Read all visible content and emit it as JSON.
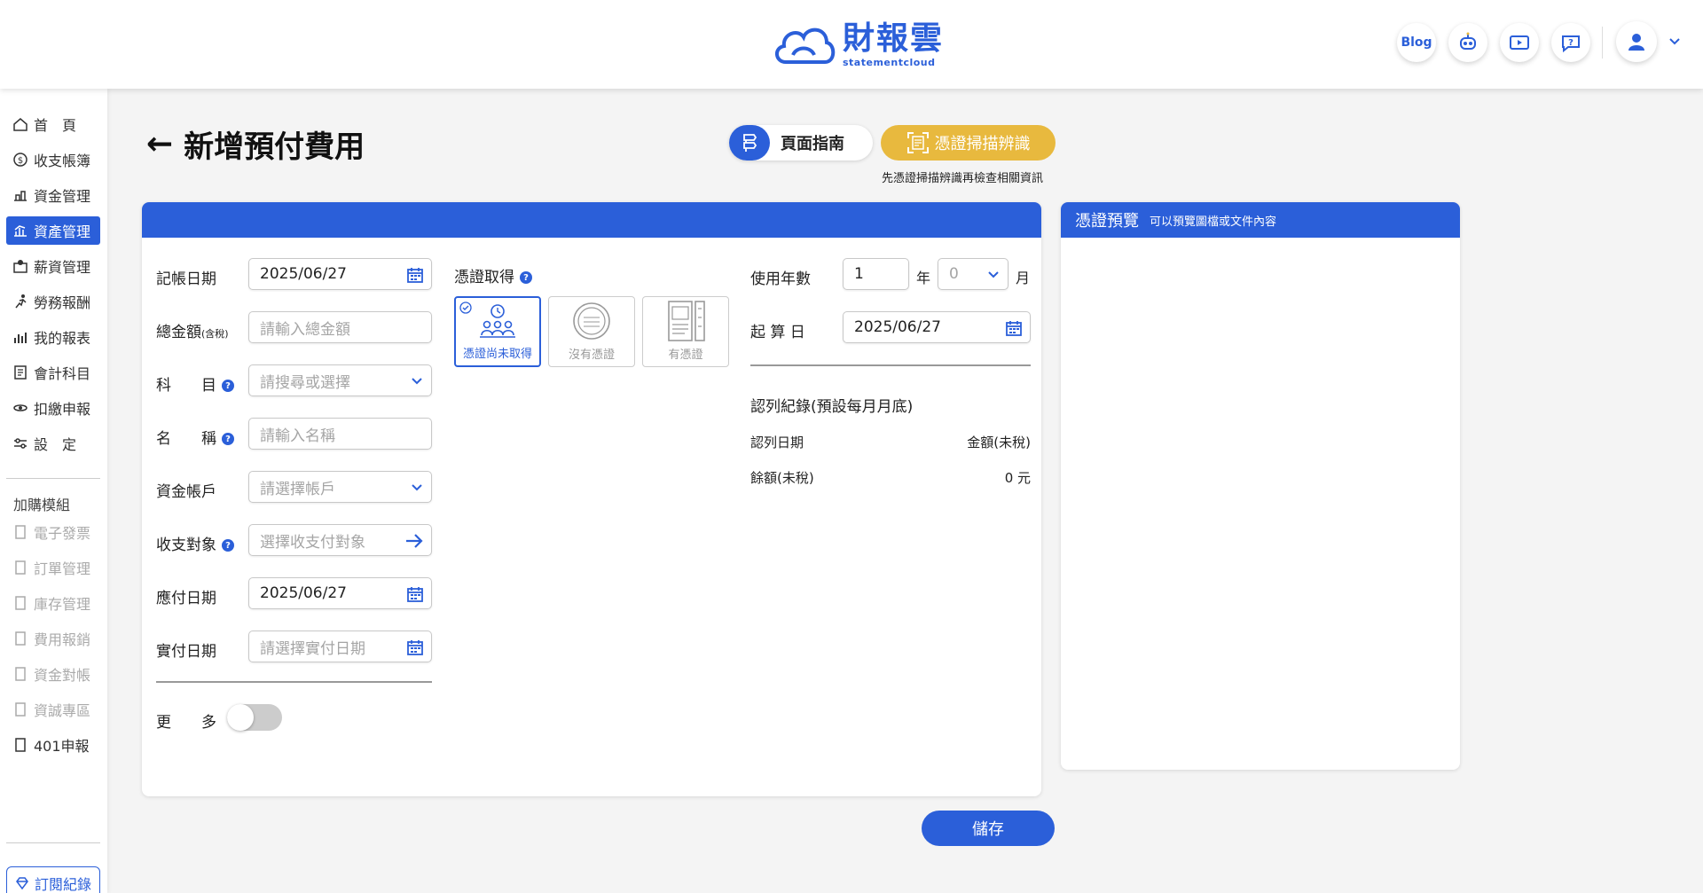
{
  "header": {
    "brand_cn": "財報雲",
    "brand_en": "statementcloud",
    "blog_label": "Blog"
  },
  "sidebar": {
    "items": [
      {
        "label": "首　頁",
        "icon": "home-icon"
      },
      {
        "label": "收支帳簿",
        "icon": "coin-icon"
      },
      {
        "label": "資金管理",
        "icon": "fund-icon"
      },
      {
        "label": "資產管理",
        "icon": "asset-chart-icon"
      },
      {
        "label": "薪資管理",
        "icon": "salary-icon"
      },
      {
        "label": "勞務報酬",
        "icon": "runner-icon"
      },
      {
        "label": "我的報表",
        "icon": "report-chart-icon"
      },
      {
        "label": "會計科目",
        "icon": "ledger-icon"
      },
      {
        "label": "扣繳申報",
        "icon": "tax-icon"
      },
      {
        "label": "設　定",
        "icon": "settings-sliders-icon"
      }
    ],
    "addon_title": "加購模組",
    "addons": [
      "電子發票",
      "訂單管理",
      "庫存管理",
      "費用報銷",
      "資金對帳",
      "資誠專區",
      "401申報"
    ],
    "subscription_label": "訂閱紀錄"
  },
  "page": {
    "title": "新增預付費用",
    "guide_label": "頁面指南",
    "scan_label": "憑證掃描辨識",
    "scan_hint": "先憑證掃描辨識再檢查相關資訊"
  },
  "form": {
    "book_date_label": "記帳日期",
    "book_date_value": "2025/06/27",
    "total_label": "總金額",
    "total_suffix": "(含稅)",
    "total_placeholder": "請輸入總金額",
    "account_label": "科　　目",
    "account_placeholder": "請搜尋或選擇",
    "name_label": "名　　稱",
    "name_placeholder": "請輸入名稱",
    "fund_account_label": "資金帳戶",
    "fund_account_placeholder": "請選擇帳戶",
    "counterparty_label": "收支對象",
    "counterparty_placeholder": "選擇收支付對象",
    "due_date_label": "應付日期",
    "due_date_value": "2025/06/27",
    "paid_date_label": "實付日期",
    "paid_date_placeholder": "請選擇實付日期",
    "more_label": "更　　多",
    "voucher_label": "憑證取得",
    "vouchers": [
      "憑證尚未取得",
      "沒有憑證",
      "有憑證"
    ],
    "years_label": "使用年數",
    "years_value": "1",
    "year_unit": "年",
    "months_value": "0",
    "month_unit": "月",
    "start_date_label": "起 算 日",
    "start_date_value": "2025/06/27",
    "record_title": "認列紀錄(預設每月月底)",
    "record_col_date": "認列日期",
    "record_col_amount": "金額(未稅)",
    "balance_label": "餘額(未稅)",
    "balance_value": "0 元"
  },
  "preview": {
    "title": "憑證預覽",
    "subtitle": "可以預覽圖檔或文件內容"
  },
  "save_label": "儲存",
  "colors": {
    "primary": "#2b5fd9",
    "scan": "#e8b93e"
  }
}
